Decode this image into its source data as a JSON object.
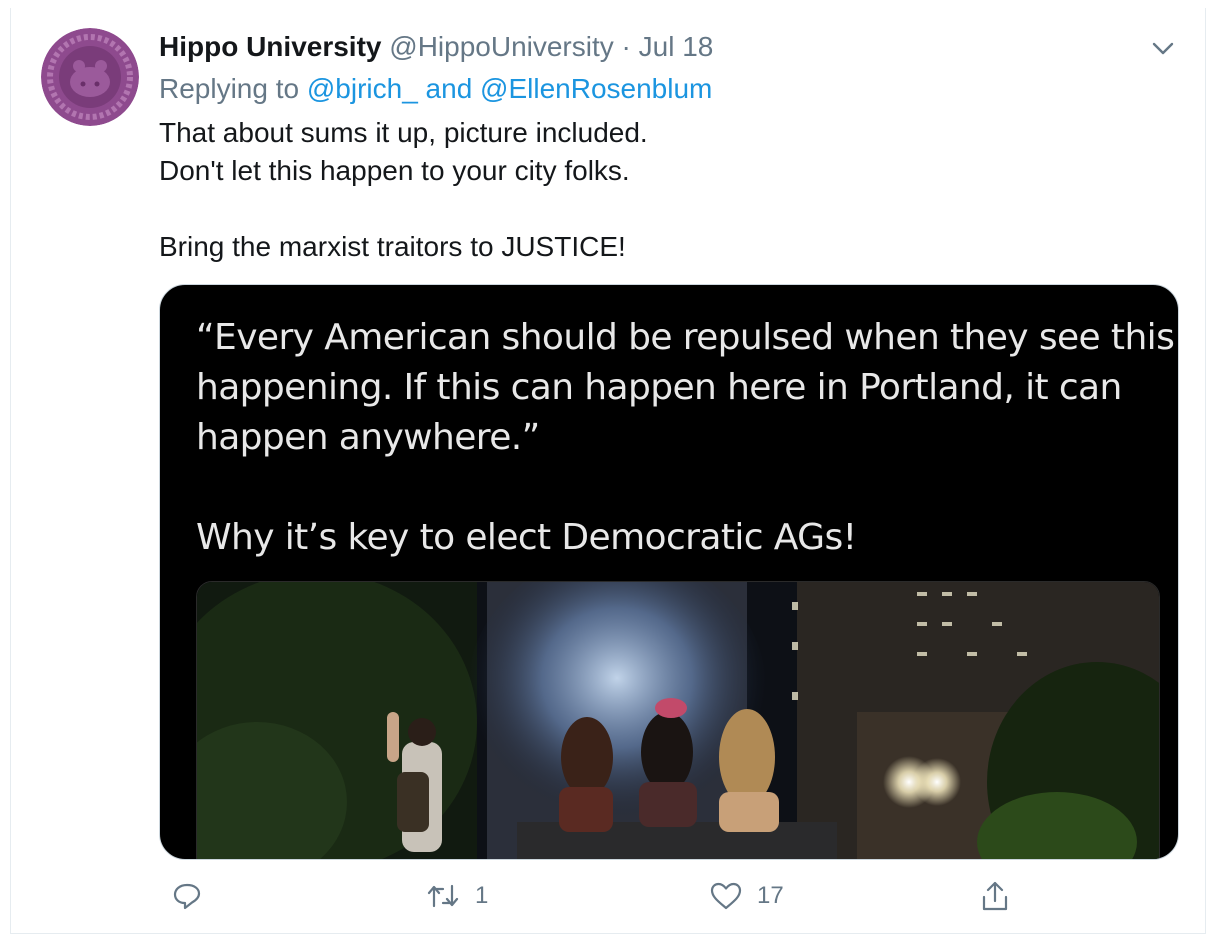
{
  "tweet": {
    "display_name": "Hippo University",
    "handle": "@HippoUniversity",
    "separator": "·",
    "date": "Jul 18",
    "replying_prefix": "Replying to ",
    "reply_mentions": "@bjrich_ and @EllenRosenblum",
    "text_lines": [
      "That about sums it up, picture included.",
      "Don't let this happen to your city folks.",
      "",
      "Bring the marxist traitors to JUSTICE!"
    ]
  },
  "media": {
    "quote_lines": [
      "“Every American should be repulsed when they see this",
      "happening. If this can happen here in Portland, it can",
      "happen anywhere.”",
      "",
      "Why it’s key to elect Democratic AGs!"
    ]
  },
  "actions": {
    "reply_icon": "reply-icon",
    "retweet_icon": "retweet-icon",
    "retweet_count": "1",
    "like_icon": "heart-icon",
    "like_count": "17",
    "share_icon": "share-icon"
  },
  "colors": {
    "link": "#1b95e0",
    "secondary_text": "#657786",
    "avatar": "#8e4a8e"
  }
}
